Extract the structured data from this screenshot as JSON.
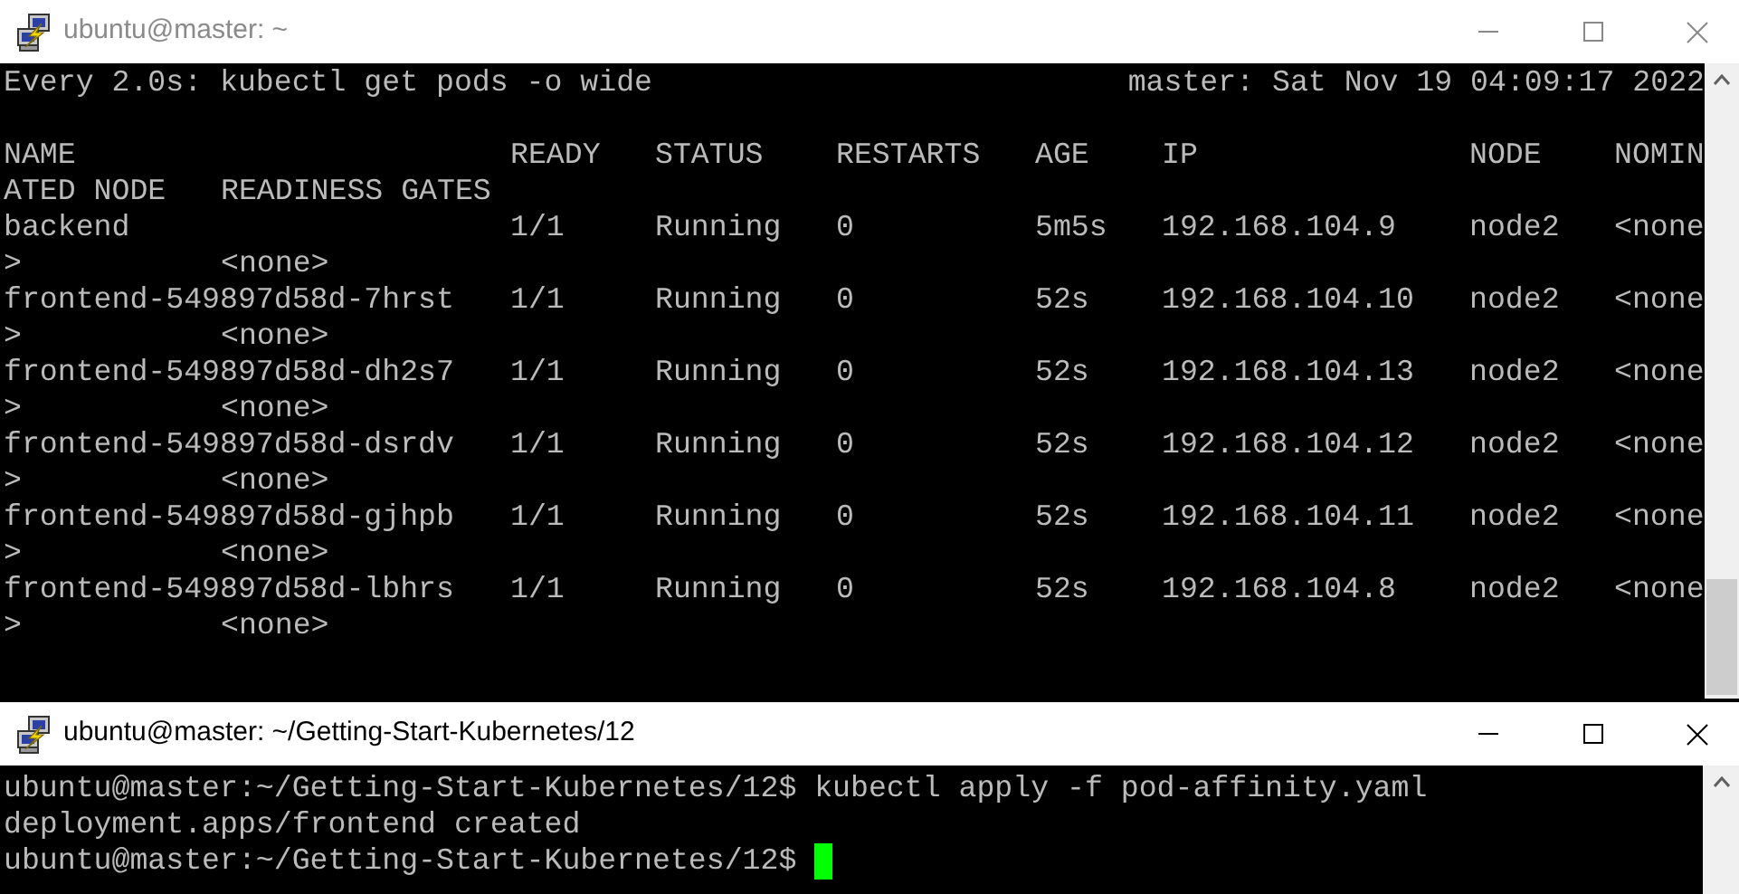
{
  "windows": [
    {
      "title": "ubuntu@master: ~",
      "active": false,
      "watch": {
        "command": "Every 2.0s: kubectl get pods -o wide",
        "host_time": "master: Sat Nov 19 04:09:17 2022"
      },
      "table": {
        "columns": [
          "NAME",
          "READY",
          "STATUS",
          "RESTARTS",
          "AGE",
          "IP",
          "NODE",
          "NOMIN"
        ],
        "columns_wrapped": [
          "ATED NODE",
          "READINESS GATES"
        ],
        "rows": [
          {
            "cells": [
              "backend",
              "1/1",
              "Running",
              "0",
              "5m5s",
              "192.168.104.9",
              "node2",
              "<none"
            ],
            "wrapped": [
              ">",
              "<none>"
            ]
          },
          {
            "cells": [
              "frontend-549897d58d-7hrst",
              "1/1",
              "Running",
              "0",
              "52s",
              "192.168.104.10",
              "node2",
              "<none"
            ],
            "wrapped": [
              ">",
              "<none>"
            ]
          },
          {
            "cells": [
              "frontend-549897d58d-dh2s7",
              "1/1",
              "Running",
              "0",
              "52s",
              "192.168.104.13",
              "node2",
              "<none"
            ],
            "wrapped": [
              ">",
              "<none>"
            ]
          },
          {
            "cells": [
              "frontend-549897d58d-dsrdv",
              "1/1",
              "Running",
              "0",
              "52s",
              "192.168.104.12",
              "node2",
              "<none"
            ],
            "wrapped": [
              ">",
              "<none>"
            ]
          },
          {
            "cells": [
              "frontend-549897d58d-gjhpb",
              "1/1",
              "Running",
              "0",
              "52s",
              "192.168.104.11",
              "node2",
              "<none"
            ],
            "wrapped": [
              ">",
              "<none>"
            ]
          },
          {
            "cells": [
              "frontend-549897d58d-lbhrs",
              "1/1",
              "Running",
              "0",
              "52s",
              "192.168.104.8",
              "node2",
              "<none"
            ],
            "wrapped": [
              ">",
              "<none>"
            ]
          }
        ]
      }
    },
    {
      "title": "ubuntu@master: ~/Getting-Start-Kubernetes/12",
      "active": true,
      "lines": [
        "ubuntu@master:~/Getting-Start-Kubernetes/12$ kubectl apply -f pod-affinity.yaml",
        "deployment.apps/frontend created",
        "ubuntu@master:~/Getting-Start-Kubernetes/12$ "
      ],
      "cursor": true
    }
  ]
}
